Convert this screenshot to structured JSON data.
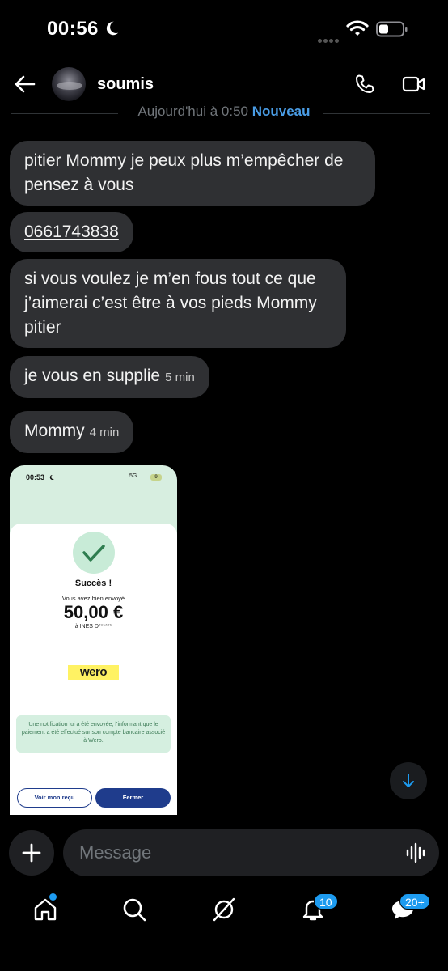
{
  "status_bar": {
    "time": "00:56"
  },
  "header": {
    "contact_name": "soumis"
  },
  "date_divider": {
    "text": "Aujourd'hui à 0:50",
    "new_label": "Nouveau"
  },
  "messages": [
    {
      "text": "pitier Mommy je peux plus m’empêcher de pensez à vous",
      "time": ""
    },
    {
      "text": "0661743838",
      "time": ""
    },
    {
      "text": "si vous voulez je m’en fous tout ce que j’aimerai c’est être à vos pieds Mommy pitier",
      "time": ""
    },
    {
      "text": "je vous en supplie",
      "time": "5 min"
    },
    {
      "text": "Mommy",
      "time": "4 min"
    }
  ],
  "attachment": {
    "status_time": "00:53",
    "network": "5G",
    "battery": "9",
    "title": "Succès !",
    "subtitle": "Vous avez bien envoyé",
    "amount": "50,00 €",
    "recipient": "à INES D******",
    "brand": "wero",
    "notification": "Une notification lui a été envoyée, l’informant que le paiement a été effectué sur son compte bancaire associé à Wero.",
    "receipt_button": "Voir mon reçu",
    "close_button": "Fermer"
  },
  "composer": {
    "placeholder": "Message"
  },
  "nav": {
    "notifications_badge": "10",
    "messages_badge": "20+"
  },
  "colors": {
    "accent": "#1d9bf0",
    "bubble": "#2f3033",
    "new_label": "#4a9de6"
  }
}
